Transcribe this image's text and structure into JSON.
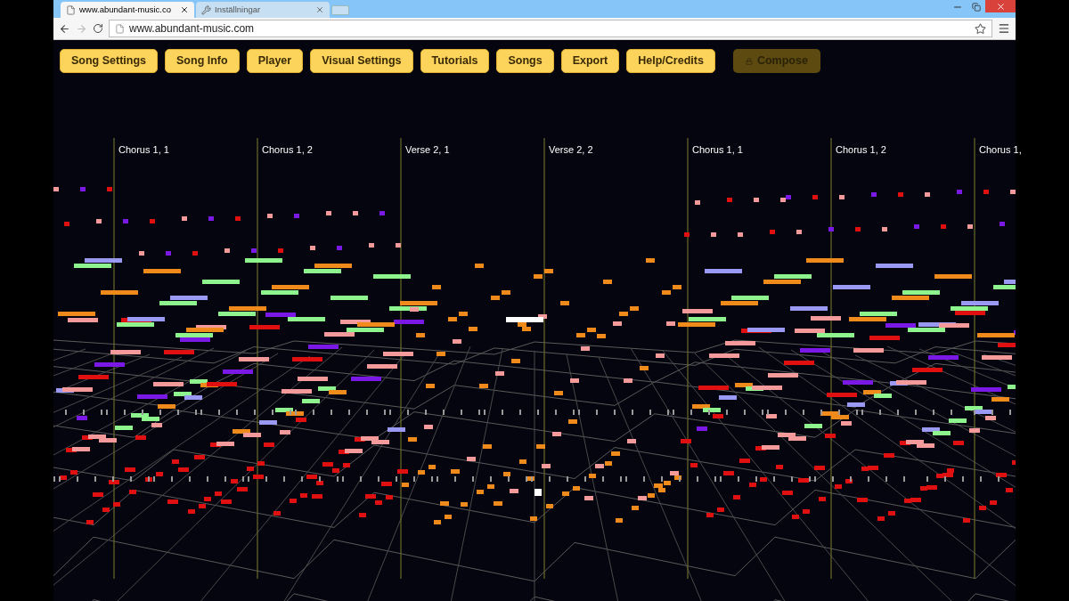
{
  "browser": {
    "tabs": [
      {
        "title": "www.abundant-music.co",
        "selected": true
      },
      {
        "title": "Inställningar",
        "selected": false
      }
    ],
    "nav": {
      "back_disabled": false,
      "forward_disabled": true
    },
    "address": "www.abundant-music.com"
  },
  "toolbar": {
    "buttons": [
      {
        "label": "Song Settings",
        "disabled": false
      },
      {
        "label": "Song Info",
        "disabled": false
      },
      {
        "label": "Player",
        "disabled": false
      },
      {
        "label": "Visual Settings",
        "disabled": false
      },
      {
        "label": "Tutorials",
        "disabled": false
      },
      {
        "label": "Songs",
        "disabled": false
      },
      {
        "label": "Export",
        "disabled": false
      },
      {
        "label": "Help/Credits",
        "disabled": false
      },
      {
        "label": "Compose",
        "disabled": true
      }
    ]
  },
  "visualizer": {
    "sections": [
      {
        "label": "Chorus 1, 1"
      },
      {
        "label": "Chorus 1, 2"
      },
      {
        "label": "Verse 2, 1"
      },
      {
        "label": "Verse 2, 2"
      },
      {
        "label": "Chorus 1, 1"
      },
      {
        "label": "Chorus 1, 2"
      },
      {
        "label": "Chorus 1,"
      }
    ]
  }
}
